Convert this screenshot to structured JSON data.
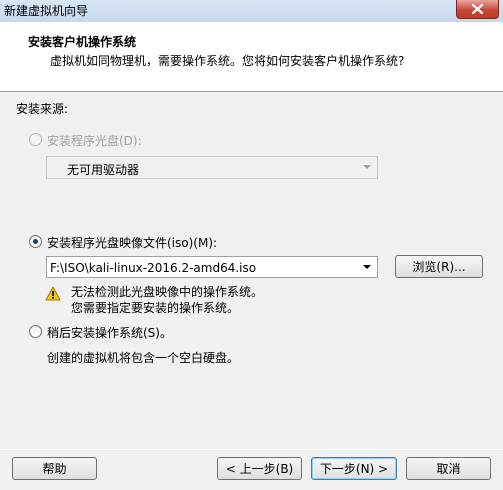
{
  "window": {
    "title": "新建虚拟机向导"
  },
  "header": {
    "title": "安装客户机操作系统",
    "subtitle": "虚拟机如同物理机，需要操作系统。您将如何安装客户机操作系统?"
  },
  "install_source": {
    "label": "安装来源:",
    "options": [
      {
        "label": "安装程序光盘(D):",
        "selected": false,
        "enabled": false
      },
      {
        "label": "安装程序光盘映像文件(iso)(M):",
        "selected": true,
        "enabled": true
      },
      {
        "label": "稍后安装操作系统(S)。",
        "selected": false,
        "enabled": true
      }
    ],
    "disc_drive_value": "无可用驱动器",
    "iso_path_value": "F:\\ISO\\kali-linux-2016.2-amd64.iso",
    "browse_label": "浏览(R)...",
    "warning_line1": "无法检测此光盘映像中的操作系统。",
    "warning_line2": "您需要指定要安装的操作系统。",
    "later_note": "创建的虚拟机将包含一个空白硬盘。"
  },
  "footer": {
    "help_label": "帮助",
    "back_label": "< 上一步(B)",
    "next_label": "下一步(N) >",
    "cancel_label": "取消"
  },
  "colors": {
    "header_bg": "#ffffff",
    "dialog_bg": "#f0f0f0",
    "close_button": "#c8493a",
    "warning_icon": "#f5c518"
  }
}
